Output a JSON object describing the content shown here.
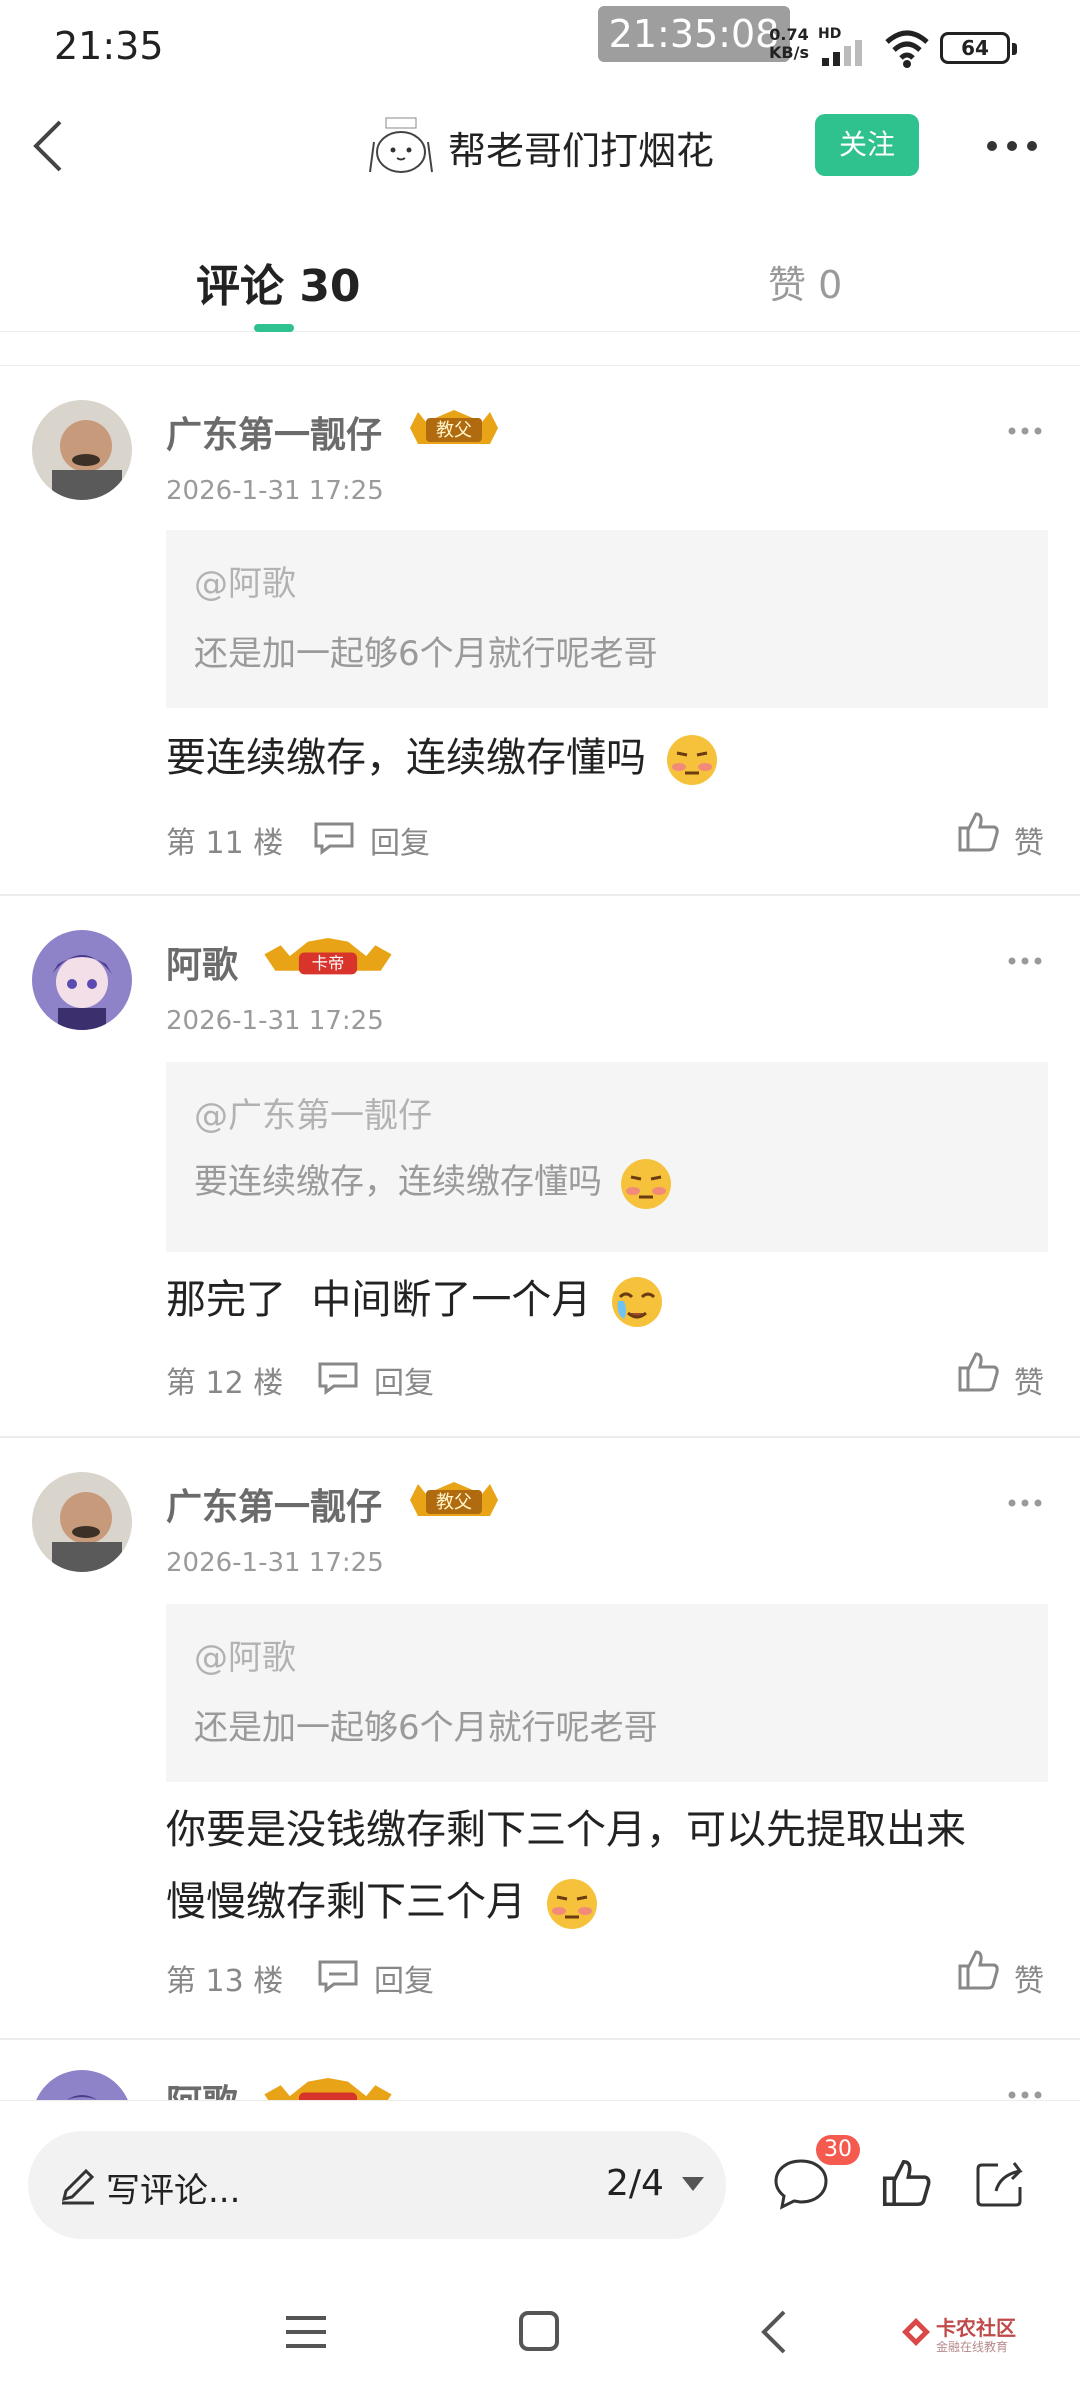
{
  "status_bar": {
    "time": "21:35",
    "overlay_time": "21:35:08",
    "network_speed": "0.74",
    "network_unit": "KB/s",
    "hd": "HD",
    "battery": "64"
  },
  "header": {
    "title": "帮老哥们打烟花",
    "follow_label": "关注"
  },
  "tabs": {
    "comments_label": "评论 30",
    "likes_label": "赞 0"
  },
  "comments": [
    {
      "username": "广东第一靓仔",
      "badge": "教父",
      "time": "2026-1-31 17:25",
      "quote_user": "@阿歌",
      "quote_text": "还是加一起够6个月就行呢老哥",
      "text": "要连续缴存，连续缴存懂吗",
      "floor": "第 11 楼",
      "reply_label": "回复",
      "like_label": "赞"
    },
    {
      "username": "阿歌",
      "badge": "卡帝",
      "time": "2026-1-31 17:25",
      "quote_user": "@广东第一靓仔",
      "quote_text": "要连续缴存，连续缴存懂吗",
      "text": "那完了  中间断了一个月",
      "floor": "第 12 楼",
      "reply_label": "回复",
      "like_label": "赞"
    },
    {
      "username": "广东第一靓仔",
      "badge": "教父",
      "time": "2026-1-31 17:25",
      "quote_user": "@阿歌",
      "quote_text": "还是加一起够6个月就行呢老哥",
      "text_line1": "你要是没钱缴存剩下三个月，可以先提取出来",
      "text_line2": "慢慢缴存剩下三个月",
      "floor": "第 13 楼",
      "reply_label": "回复",
      "like_label": "赞"
    }
  ],
  "partial_comment": {
    "username": "阿歌"
  },
  "bottom_bar": {
    "placeholder": "写评论...",
    "page": "2/4",
    "comment_count": "30"
  },
  "watermark": {
    "name": "卡农社区",
    "sub": "金融在线教育"
  },
  "colors": {
    "accent": "#2fc18e",
    "badge_red": "#f55a4e",
    "gold": "#e8a317"
  }
}
